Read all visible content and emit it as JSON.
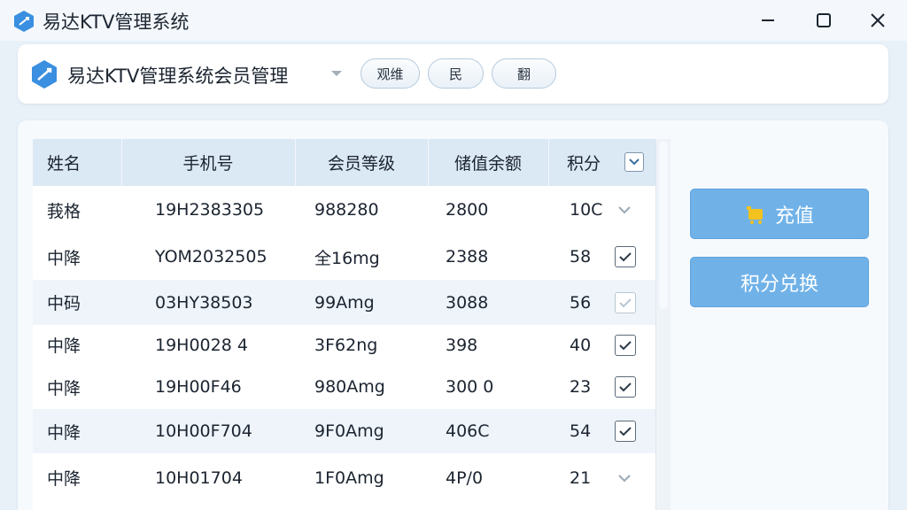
{
  "window": {
    "title": "易达KTV管理系统",
    "minimize_icon": "minimize-icon",
    "maximize_icon": "maximize-icon",
    "close_icon": "close-icon"
  },
  "header": {
    "title": "易达KTV管理系统会员管理",
    "pills": [
      "观维",
      "民",
      "翻"
    ]
  },
  "table": {
    "columns": [
      "姓名",
      "手机号",
      "会员等级",
      "储值余额",
      "积分"
    ],
    "rows": [
      {
        "name": "莪格",
        "phone": "19H2383305",
        "level": "988280",
        "balance": "2800",
        "points": "10C",
        "selector": "chevron",
        "checked": false
      },
      {
        "name": "中降",
        "phone": "YOM2032505",
        "level": "全16mg",
        "balance": "2388",
        "points": "58",
        "selector": "checkbox",
        "checked": true
      },
      {
        "name": "中码",
        "phone": "03HY38503",
        "level": "99Amg",
        "balance": "3088",
        "points": "56",
        "selector": "checkbox-light",
        "checked": true
      },
      {
        "name": "中降",
        "phone": "19H0028 4",
        "level": "3F62ng",
        "balance": "398",
        "points": "40",
        "selector": "checkbox",
        "checked": true
      },
      {
        "name": "中降",
        "phone": "19H00F46",
        "level": "980Amg",
        "balance": "300 0",
        "points": "23",
        "selector": "checkbox",
        "checked": true
      },
      {
        "name": "中降",
        "phone": "10H00F704",
        "level": "9F0Amg",
        "balance": "406C",
        "points": "54",
        "selector": "checkbox",
        "checked": true
      },
      {
        "name": "中降",
        "phone": "10H01704",
        "level": "1F0Amg",
        "balance": "4P/0",
        "points": "21",
        "selector": "chevron",
        "checked": false
      }
    ]
  },
  "actions": {
    "recharge_label": "充值",
    "redeem_label": "积分兑换"
  },
  "colors": {
    "accent": "#70b2e8",
    "header_bg": "#dbe9f5",
    "row_alt": "#eef4fa"
  }
}
